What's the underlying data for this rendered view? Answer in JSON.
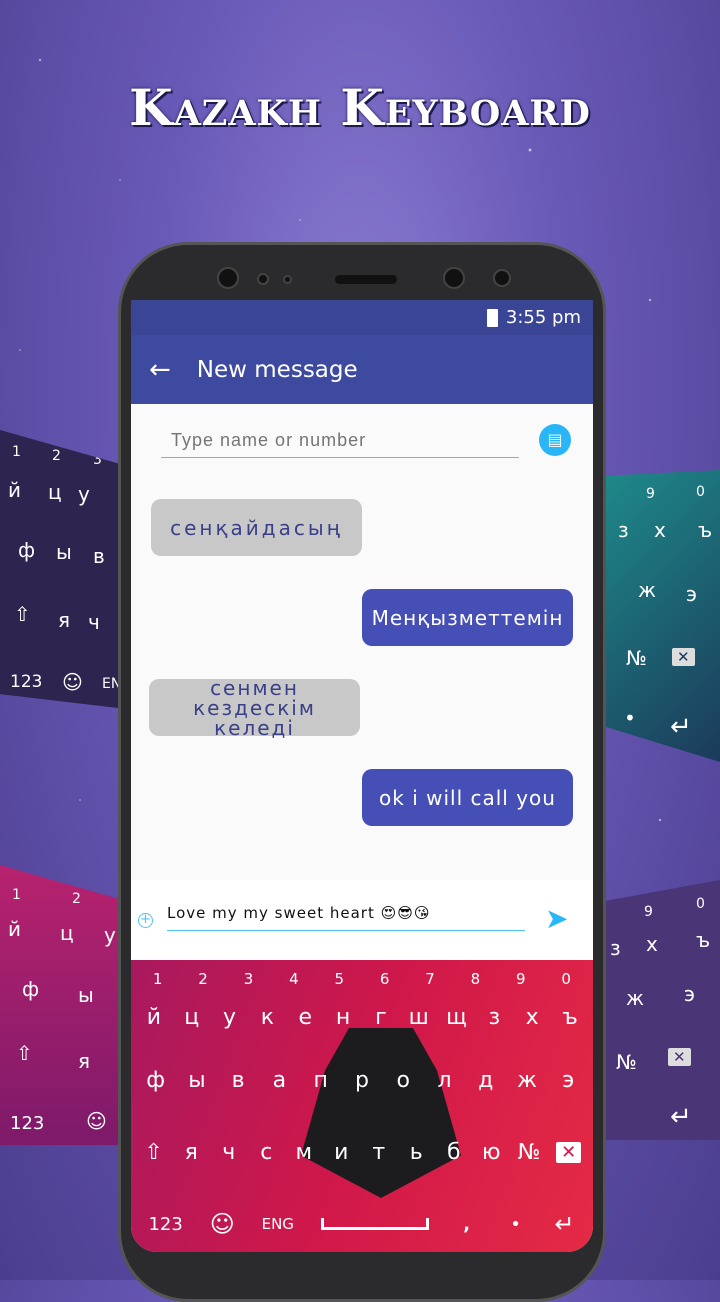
{
  "title": "Kazakh Keyboard",
  "status": {
    "time": "3:55 pm"
  },
  "appbar": {
    "back_icon": "arrow-left-icon",
    "title": "New message"
  },
  "recipient": {
    "placeholder": "Type name or number",
    "contact_icon": "contact-book-icon"
  },
  "messages": [
    {
      "dir": "in",
      "text": "сенқайдасың"
    },
    {
      "dir": "out",
      "text": "Менқызметтемін"
    },
    {
      "dir": "in",
      "text": "сенмен кездескім келеді"
    },
    {
      "dir": "out",
      "text": "ok i will call you"
    }
  ],
  "compose": {
    "value": "Love my my sweet heart 😍😎😘",
    "send_icon": "send-icon",
    "attach_icon": "plus-circle-icon"
  },
  "keyboard": {
    "numbers": [
      "1",
      "2",
      "3",
      "4",
      "5",
      "6",
      "7",
      "8",
      "9",
      "0"
    ],
    "row1": [
      "й",
      "ц",
      "у",
      "к",
      "е",
      "н",
      "г",
      "ш",
      "щ",
      "з",
      "х",
      "ъ"
    ],
    "row2": [
      "ф",
      "ы",
      "в",
      "а",
      "п",
      "р",
      "о",
      "л",
      "д",
      "ж",
      "э"
    ],
    "row3": [
      "я",
      "ч",
      "с",
      "м",
      "и",
      "т",
      "ь",
      "б",
      "ю",
      "№"
    ],
    "bottom": {
      "numbers": "123",
      "lang": "ENG",
      "comma": ",",
      "period": "•"
    },
    "theme_color": "#d0184a"
  },
  "side_panels": {
    "left_top": [
      "1",
      "2",
      "3",
      "й",
      "ц",
      "у",
      "ф",
      "ы",
      "в",
      "я",
      "ч",
      "123",
      "EN"
    ],
    "left_bottom": [
      "1",
      "2",
      "й",
      "ц",
      "у",
      "ф",
      "ы",
      "я",
      "123"
    ],
    "right_top": [
      "9",
      "0",
      "з",
      "х",
      "ъ",
      "ж",
      "э",
      "№",
      "•"
    ],
    "right_bottom": [
      "9",
      "0",
      "з",
      "х",
      "ъ",
      "ж",
      "э",
      "№"
    ]
  }
}
